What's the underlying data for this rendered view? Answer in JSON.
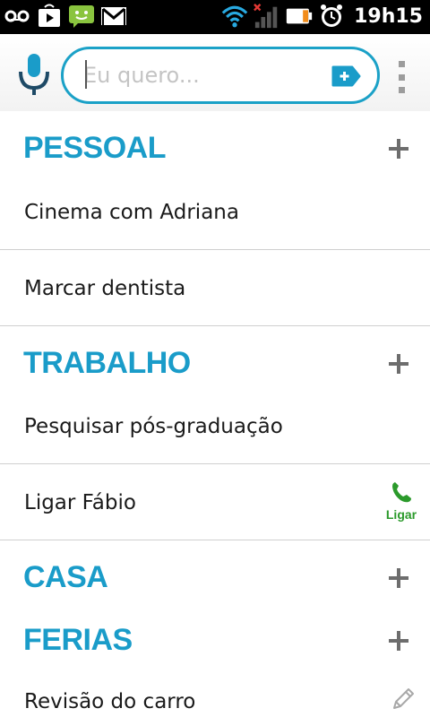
{
  "status_bar": {
    "left_icons": [
      "voicemail-icon",
      "play-store-icon",
      "sms-icon",
      "gmail-icon"
    ],
    "right_icons": [
      "wifi-icon",
      "signal-icon",
      "battery-icon",
      "alarm-icon"
    ],
    "time": "19h15"
  },
  "search": {
    "placeholder": "Eu quero...",
    "value": ""
  },
  "sections": [
    {
      "title": "PESSOAL",
      "items": [
        {
          "label": "Cinema com Adriana"
        },
        {
          "label": "Marcar dentista"
        }
      ]
    },
    {
      "title": "TRABALHO",
      "items": [
        {
          "label": "Pesquisar pós-graduação"
        },
        {
          "label": "Ligar Fábio",
          "action_label": "Ligar"
        }
      ]
    },
    {
      "title": "CASA",
      "items": []
    },
    {
      "title": "FERIAS",
      "items": [
        {
          "label": "Revisão do carro"
        }
      ]
    }
  ],
  "colors": {
    "accent": "#1a9cc9",
    "call_green": "#2b9a2b",
    "divider": "#cfcfcf"
  }
}
